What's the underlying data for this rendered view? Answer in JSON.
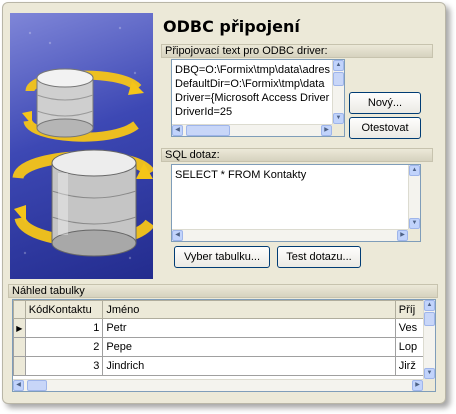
{
  "title": "ODBC připojení",
  "connection": {
    "caption": "Připojovací text pro ODBC driver:",
    "lines": [
      "DBQ=O:\\Formix\\tmp\\data\\adres",
      "DefaultDir=O:\\Formix\\tmp\\data",
      "Driver={Microsoft Access Driver",
      "DriverId=25"
    ],
    "new_label": "Nový...",
    "test_label": "Otestovat"
  },
  "sql": {
    "caption": "SQL dotaz:",
    "text": "SELECT * FROM Kontakty",
    "choose_table_label": "Vyber tabulku...",
    "test_query_label": "Test dotazu..."
  },
  "preview": {
    "caption": "Náhled tabulky",
    "columns": [
      "KódKontaktu",
      "Jméno",
      "Příj"
    ],
    "rows": [
      {
        "id": "1",
        "name": "Petr",
        "surname": "Ves"
      },
      {
        "id": "2",
        "name": "Pepe",
        "surname": "Lop"
      },
      {
        "id": "3",
        "name": "Jindrich",
        "surname": "Jirž"
      }
    ],
    "current_row_marker": "▶"
  },
  "colors": {
    "illustration_bg": "#3d48b4",
    "arrow": "#f0c020",
    "cylinder": "#c8c8c8"
  }
}
